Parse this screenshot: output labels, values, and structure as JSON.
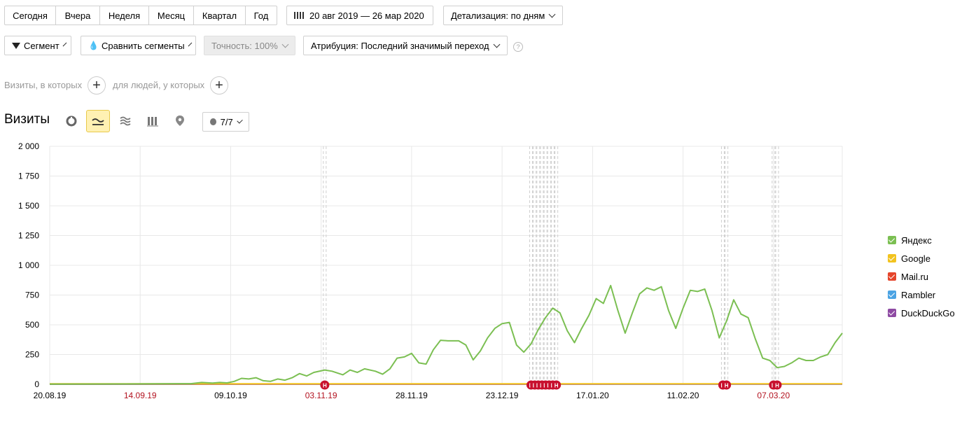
{
  "toolbar": {
    "periods": [
      "Сегодня",
      "Вчера",
      "Неделя",
      "Месяц",
      "Квартал",
      "Год"
    ],
    "date_range": "20 авг 2019 — 26 мар 2020",
    "detail": "Детализация: по дням"
  },
  "filters": {
    "segment": "Сегмент",
    "compare": "Сравнить сегменты",
    "accuracy": "Точность: 100%",
    "attribution": "Атрибуция: Последний значимый переход",
    "help": "?"
  },
  "conditions": {
    "visits_where": "Визиты, в которых",
    "people_where": "для людей, у которых"
  },
  "chart_header": {
    "title": "Визиты",
    "notes_count": "7/7"
  },
  "icons": {
    "calendar": "calendar-icon",
    "segment": "filter-icon",
    "compare": "drops-icon",
    "pie": "pie-chart-icon",
    "line": "line-chart-icon",
    "area": "area-chart-icon",
    "bar": "bar-chart-icon",
    "map": "map-pin-icon",
    "note": "speech-bubble-icon"
  },
  "chart_data": {
    "type": "line",
    "y_ticks": [
      "2 000",
      "1 750",
      "1 500",
      "1 250",
      "1 000",
      "750",
      "500",
      "250",
      "0"
    ],
    "ylim": [
      0,
      2000
    ],
    "x_range": [
      "2019-08-20",
      "2020-03-26"
    ],
    "x_ticks": [
      {
        "date": "2019-08-20",
        "label": "20.08.19",
        "weekend": false
      },
      {
        "date": "2019-09-14",
        "label": "14.09.19",
        "weekend": true
      },
      {
        "date": "2019-10-09",
        "label": "09.10.19",
        "weekend": false
      },
      {
        "date": "2019-11-03",
        "label": "03.11.19",
        "weekend": true
      },
      {
        "date": "2019-11-28",
        "label": "28.11.19",
        "weekend": false
      },
      {
        "date": "2019-12-23",
        "label": "23.12.19",
        "weekend": false
      },
      {
        "date": "2020-01-17",
        "label": "17.01.20",
        "weekend": false
      },
      {
        "date": "2020-02-11",
        "label": "11.02.20",
        "weekend": false
      },
      {
        "date": "2020-03-07",
        "label": "07.03.20",
        "weekend": true
      }
    ],
    "grid": true,
    "legend_position": "right",
    "holiday_marker_label": "Н",
    "holidays": [
      "2019-11-04",
      "2019-12-31",
      "2020-01-01",
      "2020-01-02",
      "2020-01-03",
      "2020-01-04",
      "2020-01-05",
      "2020-01-06",
      "2020-01-07",
      "2020-02-22",
      "2020-02-23",
      "2020-03-07",
      "2020-03-08"
    ],
    "series": [
      {
        "name": "Яндекс",
        "color": "#7bbf52",
        "points": [
          [
            "2019-08-20",
            2
          ],
          [
            "2019-09-10",
            3
          ],
          [
            "2019-09-28",
            5
          ],
          [
            "2019-10-01",
            15
          ],
          [
            "2019-10-04",
            10
          ],
          [
            "2019-10-06",
            15
          ],
          [
            "2019-10-08",
            12
          ],
          [
            "2019-10-10",
            25
          ],
          [
            "2019-10-12",
            50
          ],
          [
            "2019-10-14",
            45
          ],
          [
            "2019-10-16",
            55
          ],
          [
            "2019-10-18",
            30
          ],
          [
            "2019-10-20",
            25
          ],
          [
            "2019-10-22",
            45
          ],
          [
            "2019-10-24",
            35
          ],
          [
            "2019-10-26",
            55
          ],
          [
            "2019-10-28",
            90
          ],
          [
            "2019-10-30",
            70
          ],
          [
            "2019-11-01",
            100
          ],
          [
            "2019-11-04",
            120
          ],
          [
            "2019-11-06",
            110
          ],
          [
            "2019-11-09",
            80
          ],
          [
            "2019-11-11",
            120
          ],
          [
            "2019-11-13",
            100
          ],
          [
            "2019-11-15",
            130
          ],
          [
            "2019-11-18",
            110
          ],
          [
            "2019-11-20",
            85
          ],
          [
            "2019-11-22",
            130
          ],
          [
            "2019-11-24",
            220
          ],
          [
            "2019-11-26",
            230
          ],
          [
            "2019-11-28",
            260
          ],
          [
            "2019-11-30",
            180
          ],
          [
            "2019-12-02",
            170
          ],
          [
            "2019-12-04",
            290
          ],
          [
            "2019-12-06",
            370
          ],
          [
            "2019-12-08",
            365
          ],
          [
            "2019-12-11",
            365
          ],
          [
            "2019-12-13",
            330
          ],
          [
            "2019-12-15",
            205
          ],
          [
            "2019-12-17",
            280
          ],
          [
            "2019-12-19",
            390
          ],
          [
            "2019-12-21",
            470
          ],
          [
            "2019-12-23",
            510
          ],
          [
            "2019-12-25",
            520
          ],
          [
            "2019-12-27",
            330
          ],
          [
            "2019-12-29",
            270
          ],
          [
            "2019-12-31",
            340
          ],
          [
            "2020-01-02",
            460
          ],
          [
            "2020-01-04",
            560
          ],
          [
            "2020-01-06",
            640
          ],
          [
            "2020-01-08",
            600
          ],
          [
            "2020-01-10",
            450
          ],
          [
            "2020-01-12",
            350
          ],
          [
            "2020-01-14",
            470
          ],
          [
            "2020-01-16",
            580
          ],
          [
            "2020-01-18",
            720
          ],
          [
            "2020-01-20",
            680
          ],
          [
            "2020-01-22",
            830
          ],
          [
            "2020-01-24",
            620
          ],
          [
            "2020-01-26",
            430
          ],
          [
            "2020-01-28",
            600
          ],
          [
            "2020-01-30",
            760
          ],
          [
            "2020-02-01",
            810
          ],
          [
            "2020-02-03",
            790
          ],
          [
            "2020-02-05",
            820
          ],
          [
            "2020-02-07",
            620
          ],
          [
            "2020-02-09",
            470
          ],
          [
            "2020-02-11",
            640
          ],
          [
            "2020-02-13",
            790
          ],
          [
            "2020-02-15",
            780
          ],
          [
            "2020-02-17",
            800
          ],
          [
            "2020-02-19",
            620
          ],
          [
            "2020-02-21",
            390
          ],
          [
            "2020-02-23",
            530
          ],
          [
            "2020-02-25",
            710
          ],
          [
            "2020-02-27",
            590
          ],
          [
            "2020-02-29",
            560
          ],
          [
            "2020-03-02",
            380
          ],
          [
            "2020-03-04",
            220
          ],
          [
            "2020-03-06",
            200
          ],
          [
            "2020-03-08",
            140
          ],
          [
            "2020-03-10",
            150
          ],
          [
            "2020-03-12",
            180
          ],
          [
            "2020-03-14",
            220
          ],
          [
            "2020-03-16",
            200
          ],
          [
            "2020-03-18",
            200
          ],
          [
            "2020-03-20",
            230
          ],
          [
            "2020-03-22",
            250
          ],
          [
            "2020-03-24",
            350
          ],
          [
            "2020-03-26",
            430
          ]
        ]
      },
      {
        "name": "Google",
        "color": "#f2c31f",
        "points": [
          [
            "2019-08-20",
            4
          ],
          [
            "2020-03-26",
            4
          ]
        ]
      },
      {
        "name": "Mail.ru",
        "color": "#e5452b",
        "points": [
          [
            "2019-08-20",
            2
          ],
          [
            "2020-03-26",
            3
          ]
        ]
      },
      {
        "name": "Rambler",
        "color": "#4ba3e3",
        "points": [
          [
            "2019-08-20",
            1
          ],
          [
            "2020-03-26",
            1
          ]
        ]
      },
      {
        "name": "DuckDuckGo",
        "color": "#8e4aa3",
        "points": [
          [
            "2019-08-20",
            1
          ],
          [
            "2020-03-26",
            2
          ]
        ]
      }
    ]
  }
}
